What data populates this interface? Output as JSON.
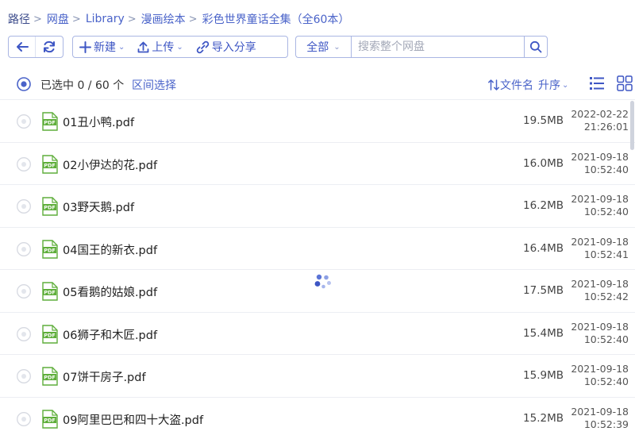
{
  "breadcrumb": {
    "items": [
      "路径",
      "网盘",
      "Library",
      "漫画绘本",
      "彩色世界童话全集（全60本）"
    ]
  },
  "toolbar": {
    "new_label": "新建",
    "upload_label": "上传",
    "import_label": "导入分享",
    "search_scope": "全部",
    "search_placeholder": "搜索整个网盘"
  },
  "selection": {
    "count_text": "已选中 0 / 60 个",
    "range_select": "区间选择"
  },
  "sort": {
    "field": "文件名",
    "order": "升序"
  },
  "files": [
    {
      "name": "01丑小鸭.pdf",
      "size": "19.5MB",
      "date": "2022-02-22",
      "time": "21:26:01"
    },
    {
      "name": "02小伊达的花.pdf",
      "size": "16.0MB",
      "date": "2021-09-18",
      "time": "10:52:40"
    },
    {
      "name": "03野天鹅.pdf",
      "size": "16.2MB",
      "date": "2021-09-18",
      "time": "10:52:40"
    },
    {
      "name": "04国王的新衣.pdf",
      "size": "16.4MB",
      "date": "2021-09-18",
      "time": "10:52:41"
    },
    {
      "name": "05看鹅的姑娘.pdf",
      "size": "17.5MB",
      "date": "2021-09-18",
      "time": "10:52:42"
    },
    {
      "name": "06狮子和木匠.pdf",
      "size": "15.4MB",
      "date": "2021-09-18",
      "time": "10:52:40"
    },
    {
      "name": "07饼干房子.pdf",
      "size": "15.9MB",
      "date": "2021-09-18",
      "time": "10:52:40"
    },
    {
      "name": "09阿里巴巴和四十大盗.pdf",
      "size": "15.2MB",
      "date": "2021-09-18",
      "time": "10:52:39"
    }
  ],
  "icons": {
    "back": "arrow-left-icon",
    "refresh": "refresh-icon",
    "new": "plus-icon",
    "upload": "upload-icon",
    "import": "link-icon",
    "search": "search-icon",
    "file": "pdf-file-icon",
    "list_view": "list-view-icon",
    "grid_view": "grid-view-icon",
    "loading": "loading-spinner-icon"
  },
  "colors": {
    "accent": "#3e56c4",
    "link": "#4a63c9",
    "pdf_green": "#5fae3b"
  }
}
